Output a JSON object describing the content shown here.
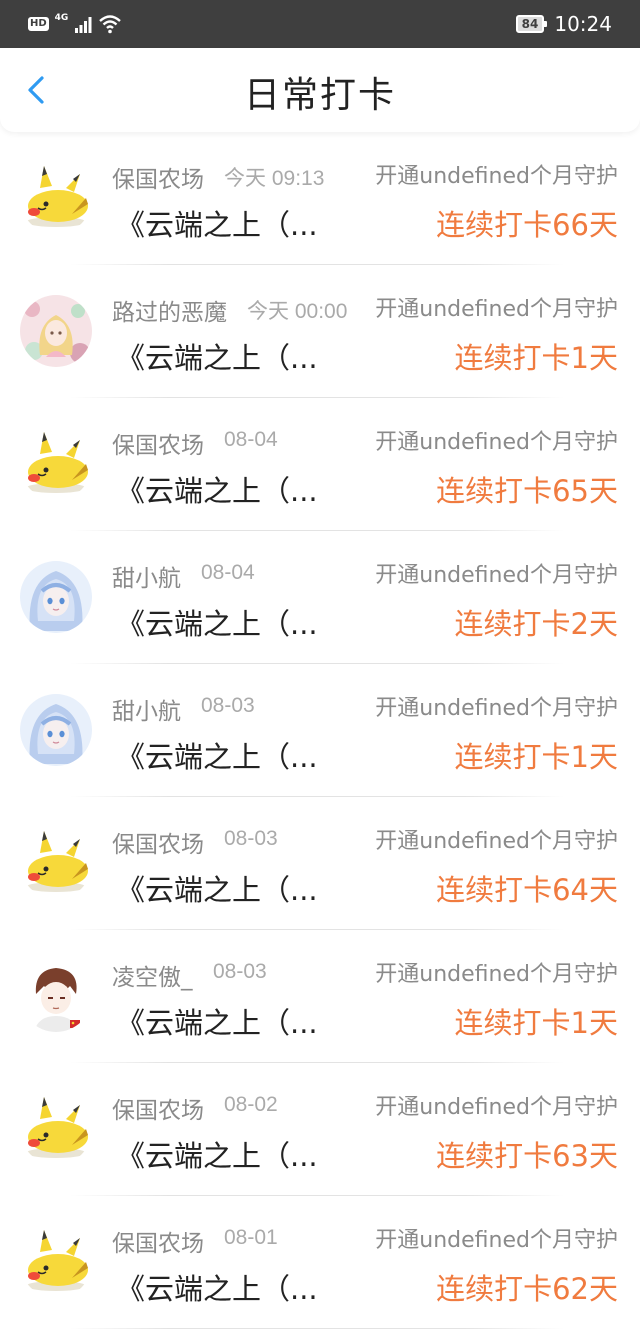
{
  "status_bar": {
    "hd": "HD",
    "network": "4G",
    "battery": "84",
    "time": "10:24"
  },
  "nav": {
    "title": "日常打卡"
  },
  "colors": {
    "accent": "#f07b3f",
    "back_icon": "#2f9bf2",
    "status_bar_bg": "#3f3f3f"
  },
  "items": [
    {
      "name": "保国农场",
      "time": "今天 09:13",
      "guard": "开通undefined个月守护",
      "book": "《云端之上（...",
      "streak": "连续打卡66天",
      "avatar": "pikachu"
    },
    {
      "name": "路过的恶魔",
      "time": "今天 00:00",
      "guard": "开通undefined个月守护",
      "book": "《云端之上（...",
      "streak": "连续打卡1天",
      "avatar": "anime-girl-pink"
    },
    {
      "name": "保国农场",
      "time": "08-04",
      "guard": "开通undefined个月守护",
      "book": "《云端之上（...",
      "streak": "连续打卡65天",
      "avatar": "pikachu"
    },
    {
      "name": "甜小航",
      "time": "08-04",
      "guard": "开通undefined个月守护",
      "book": "《云端之上（...",
      "streak": "连续打卡2天",
      "avatar": "anime-girl-blue"
    },
    {
      "name": "甜小航",
      "time": "08-03",
      "guard": "开通undefined个月守护",
      "book": "《云端之上（...",
      "streak": "连续打卡1天",
      "avatar": "anime-girl-blue"
    },
    {
      "name": "保国农场",
      "time": "08-03",
      "guard": "开通undefined个月守护",
      "book": "《云端之上（...",
      "streak": "连续打卡64天",
      "avatar": "pikachu"
    },
    {
      "name": "凌空傲_",
      "time": "08-03",
      "guard": "开通undefined个月守护",
      "book": "《云端之上（...",
      "streak": "连续打卡1天",
      "avatar": "anime-boy"
    },
    {
      "name": "保国农场",
      "time": "08-02",
      "guard": "开通undefined个月守护",
      "book": "《云端之上（...",
      "streak": "连续打卡63天",
      "avatar": "pikachu"
    },
    {
      "name": "保国农场",
      "time": "08-01",
      "guard": "开通undefined个月守护",
      "book": "《云端之上（...",
      "streak": "连续打卡62天",
      "avatar": "pikachu"
    }
  ]
}
